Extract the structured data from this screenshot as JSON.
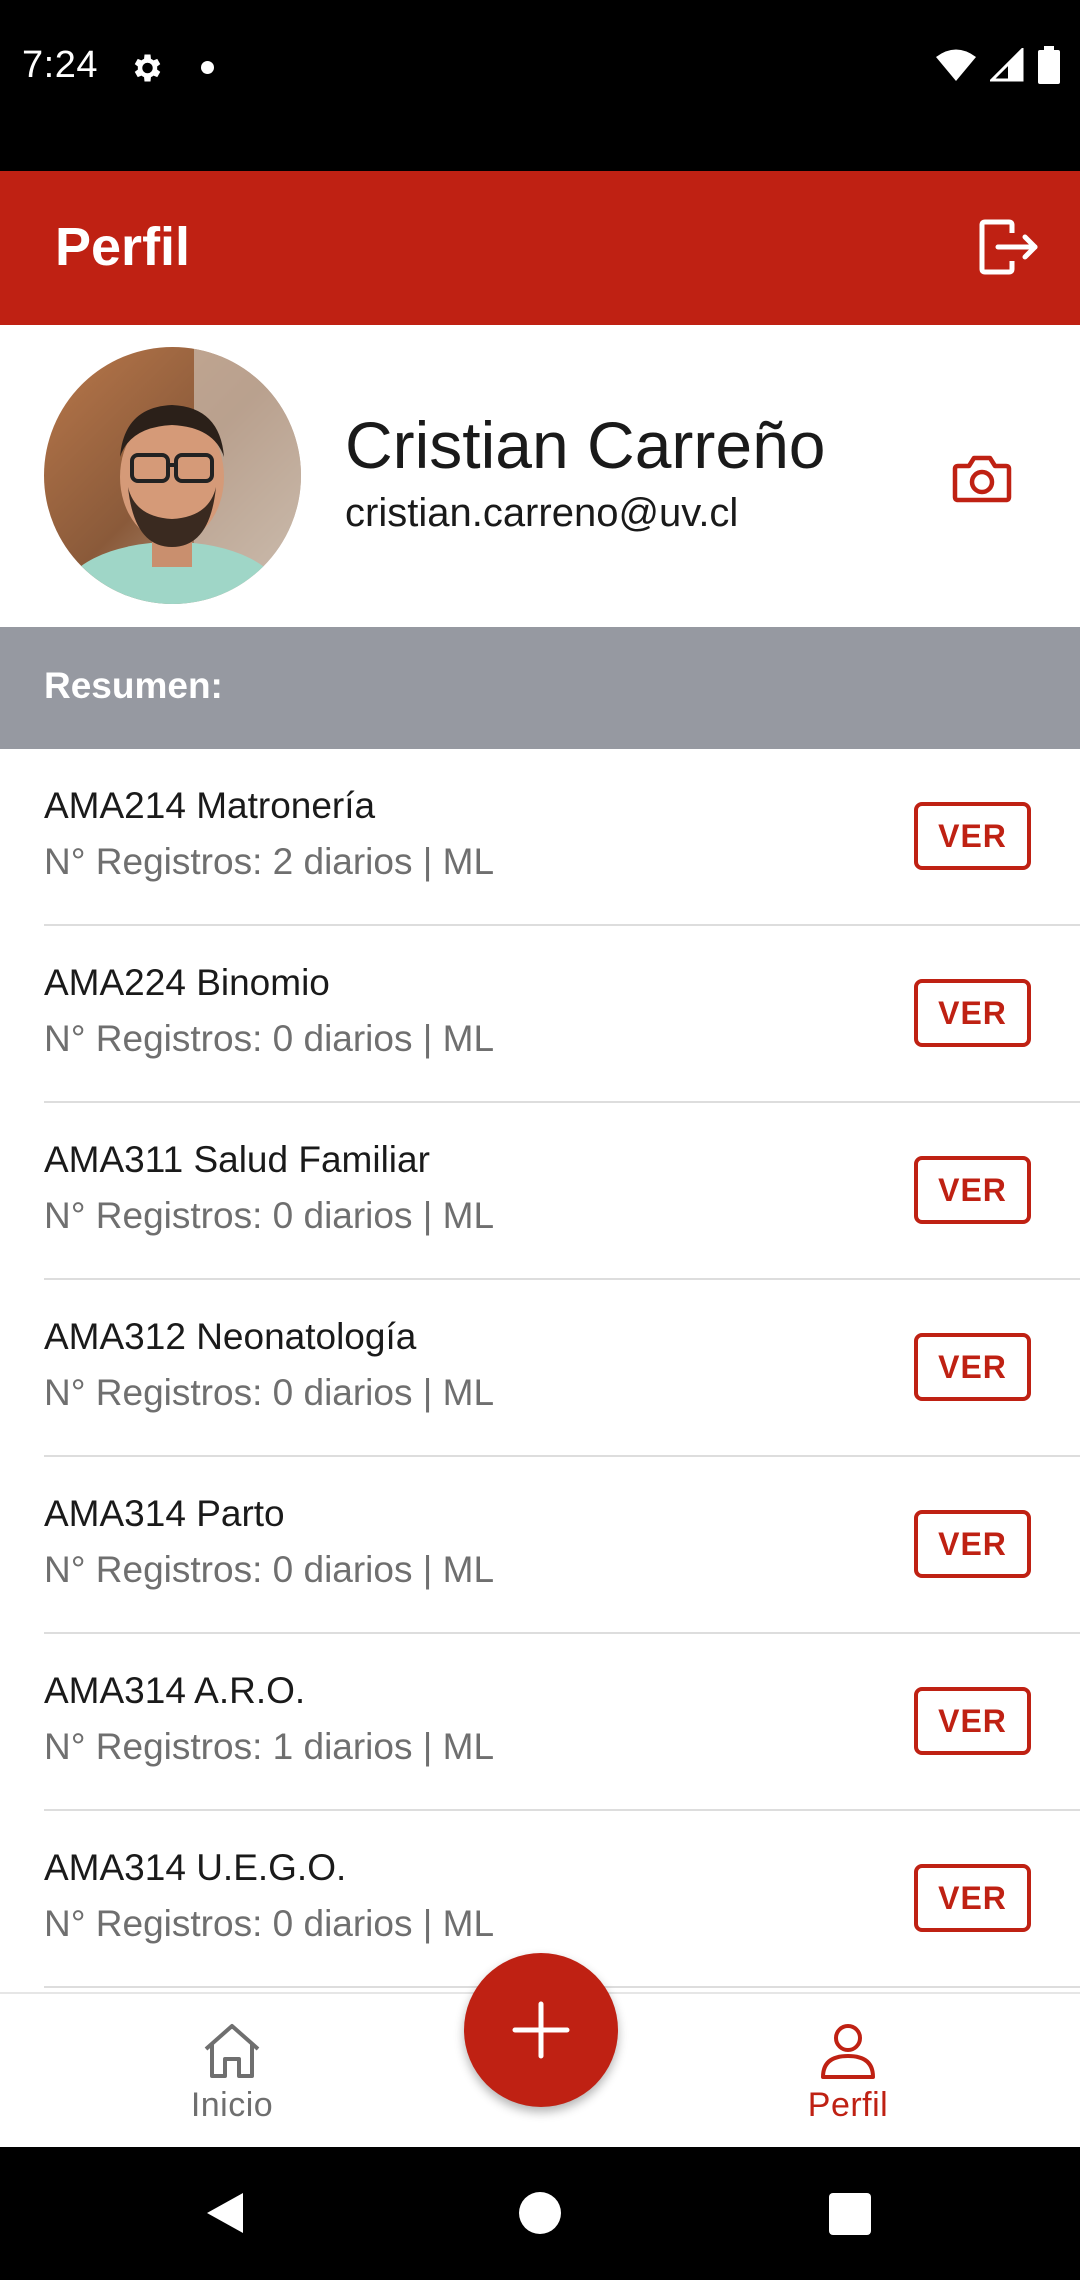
{
  "status_bar": {
    "time": "7:24"
  },
  "app_bar": {
    "title": "Perfil"
  },
  "profile": {
    "name": "Cristian Carreño",
    "email": "cristian.carreno@uv.cl"
  },
  "summary": {
    "label": "Resumen:"
  },
  "courses": [
    {
      "name": "AMA214 Matronería",
      "records": "N° Registros: 2 diarios | ML",
      "button": "VER"
    },
    {
      "name": "AMA224 Binomio",
      "records": "N° Registros: 0 diarios | ML",
      "button": "VER"
    },
    {
      "name": "AMA311 Salud Familiar",
      "records": "N° Registros: 0 diarios | ML",
      "button": "VER"
    },
    {
      "name": "AMA312 Neonatología",
      "records": "N° Registros: 0 diarios | ML",
      "button": "VER"
    },
    {
      "name": "AMA314 Parto",
      "records": "N° Registros: 0 diarios | ML",
      "button": "VER"
    },
    {
      "name": "AMA314 A.R.O.",
      "records": "N° Registros: 1 diarios | ML",
      "button": "VER"
    },
    {
      "name": "AMA314 U.E.G.O.",
      "records": "N° Registros: 0 diarios | ML",
      "button": "VER"
    }
  ],
  "bottom_nav": {
    "items": [
      {
        "label": "Inicio",
        "icon": "home-icon",
        "active": false
      },
      {
        "label": "Perfil",
        "icon": "person-icon",
        "active": true
      }
    ],
    "fab_icon": "plus-icon"
  },
  "colors": {
    "primary": "#BF2113",
    "summary_bg": "#9699A1",
    "secondary_text": "#6f6f6f"
  }
}
